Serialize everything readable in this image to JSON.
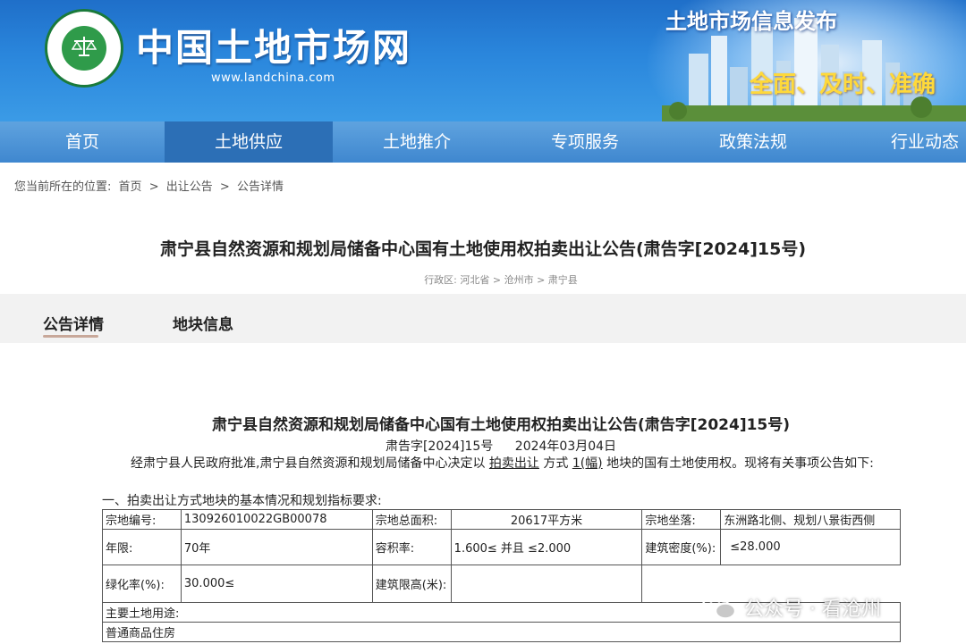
{
  "header": {
    "site_title": "中国土地市场网",
    "site_url": "www.landchina.com",
    "slogan_top": "土地市场信息发布",
    "slogan_bottom": "全面、及时、准确"
  },
  "nav": {
    "items": [
      {
        "label": "首页"
      },
      {
        "label": "土地供应"
      },
      {
        "label": "土地推介"
      },
      {
        "label": "专项服务"
      },
      {
        "label": "政策法规"
      },
      {
        "label": "行业动态"
      }
    ],
    "active_index": 1
  },
  "breadcrumb": {
    "prefix": "您当前所在的位置:",
    "items": [
      "首页",
      "出让公告",
      "公告详情"
    ],
    "separator": ">"
  },
  "page": {
    "title": "肃宁县自然资源和规划局储备中心国有土地使用权拍卖出让公告(肃告字[2024]15号)",
    "region": "行政区: 河北省 > 沧州市 > 肃宁县"
  },
  "tabs": [
    {
      "label": "公告详情"
    },
    {
      "label": "地块信息"
    }
  ],
  "notice": {
    "title": "肃宁县自然资源和规划局储备中心国有土地使用权拍卖出让公告(肃告字[2024]15号)",
    "doc_no": "肃告字[2024]15号",
    "date": "2024年03月04日",
    "para_1": "经肃宁县人民政府批准,肃宁县自然资源和规划局储备中心决定以",
    "para_method": "拍卖出让",
    "para_2": "方式",
    "para_count": "1(幅)",
    "para_3": "地块的国有土地使用权。现将有关事项公告如下:",
    "section_1": "一、拍卖出让方式地块的基本情况和规划指标要求:"
  },
  "land_table": {
    "parcel_no_label": "宗地编号:",
    "parcel_no": "130926010022GB00078",
    "area_label": "宗地总面积:",
    "area": "20617平方米",
    "location_label": "宗地坐落:",
    "location": "东洲路北侧、规划八景街西侧",
    "term_label": "年限:",
    "term": "70年",
    "far_label": "容积率:",
    "far": "1.600≤ 并且 ≤2.000",
    "density_label": "建筑密度(%):",
    "density": "≤28.000",
    "green_label": "绿化率(%):",
    "green": "30.000≤",
    "height_label": "建筑限高(米):",
    "height": "",
    "use_label": "主要土地用途:",
    "use": "普通商品住房"
  },
  "watermark": {
    "text": "公众号 · 看沧州"
  },
  "colors": {
    "banner": "#2a86dc",
    "nav": "#4a8fd4",
    "nav_active": "#2c6fb6",
    "tab_underline": "#c8a89a",
    "slogan_accent": "#ffd93a"
  }
}
